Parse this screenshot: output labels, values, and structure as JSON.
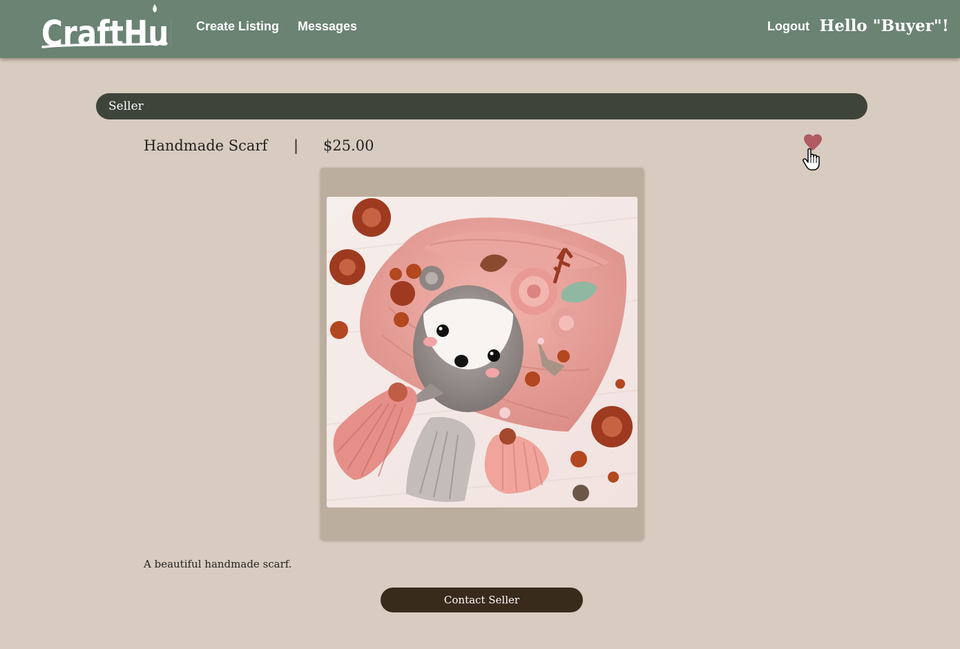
{
  "header": {
    "logo_text": "CraftHub",
    "nav": {
      "create_listing": "Create Listing",
      "messages": "Messages",
      "logout": "Logout"
    },
    "greeting": "Hello \"Buyer\"!"
  },
  "listing": {
    "seller_label": "Seller",
    "title": "Handmade Scarf",
    "separator": "|",
    "price": "$25.00",
    "favorite_icon": "heart-icon",
    "image_subject": "knitted pink scarf with raccoon face",
    "description": "A beautiful handmade scarf.",
    "contact_label": "Contact Seller"
  },
  "colors": {
    "page_bg": "#d8cbbf",
    "navbar": "#6a8373",
    "seller_bar": "#3e443a",
    "image_frame": "#bcae9e",
    "button": "#382b1c",
    "heart": "#b05a62"
  }
}
